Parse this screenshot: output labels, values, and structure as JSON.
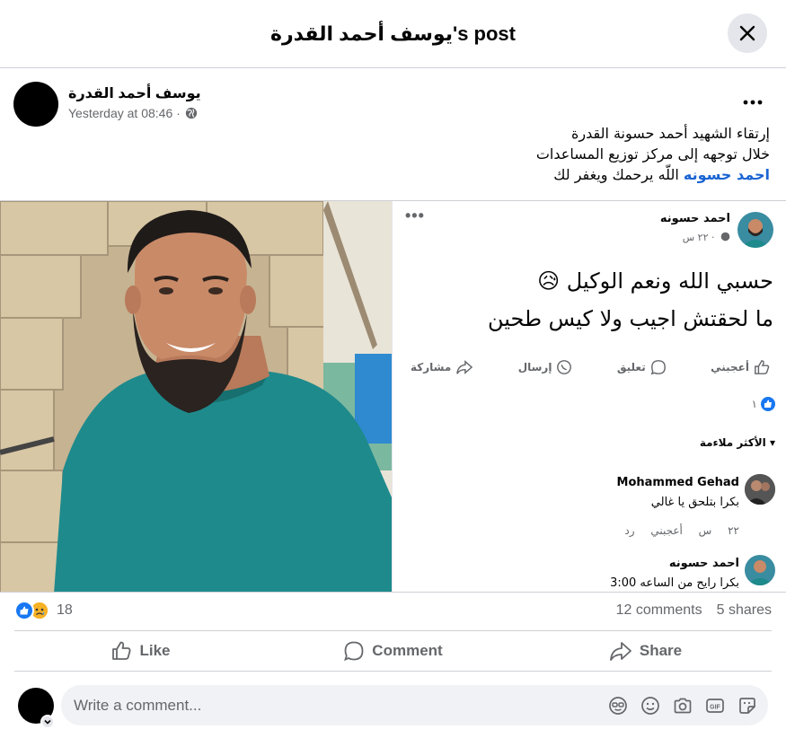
{
  "dialog": {
    "title": "يوسف أحمد القدرة's post"
  },
  "post": {
    "author": "يوسف أحمد القدرة",
    "time": "Yesterday at 08:46 ·",
    "audience_icon": "globe-icon",
    "text_line1": "إرتقاء الشهيد أحمد حسونة القدرة",
    "text_line2": "خلال توجهه إلى مركز توزيع المساعدات",
    "text_tag": "احمد حسونه",
    "text_line3_rest": "اللّه يرحمك ويغفر لك"
  },
  "shared_screenshot": {
    "name": "احمد حسونه",
    "meta": "٢٢ س ·",
    "body_line1": "حسبي الله ونعم الوكيل 😥",
    "body_line2": "ما لحقتش اجيب ولا كيس طحين",
    "like_label": "أعجبني",
    "comment_label": "تعليق",
    "send_label": "إرسال",
    "share_label": "مشاركة",
    "like_count": "١",
    "sort_label": "الأكثر ملاءمة",
    "comments": [
      {
        "name": "Mohammed Gehad",
        "text": "بكرا بتلحق يا غالي",
        "meta": "٢٢ س أعجبني رد"
      },
      {
        "name": "احمد حسونه",
        "text": "بكرا رايح من الساعه 3:00"
      }
    ]
  },
  "stats": {
    "reaction_count": "18",
    "comments": "12 comments",
    "shares": "5 shares"
  },
  "actions": {
    "like": "Like",
    "comment": "Comment",
    "share": "Share"
  },
  "composer": {
    "placeholder": "Write a comment..."
  },
  "colors": {
    "accent": "#1877f2",
    "tag": "#1a64d3",
    "secondary_text": "#65676b",
    "divider": "#ced0d4"
  }
}
